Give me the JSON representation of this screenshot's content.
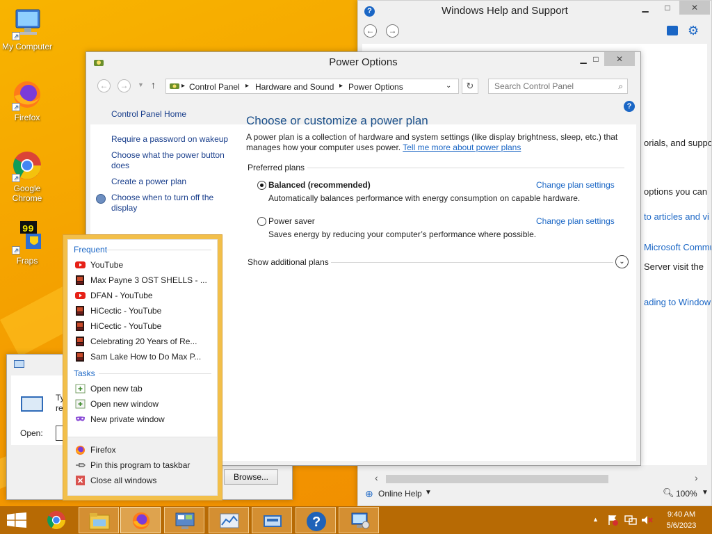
{
  "desktop": {
    "icons": [
      {
        "label": "My Computer"
      },
      {
        "label": "Firefox"
      },
      {
        "label": "Google Chrome"
      },
      {
        "label": "Fraps"
      }
    ]
  },
  "help_window": {
    "title": "Windows Help and Support",
    "snippets": [
      "orials, and suppo",
      "options you can",
      "to articles and vi",
      "Microsoft Commu",
      "Server visit the",
      "ading to Window"
    ],
    "online_help": "Online Help",
    "zoom": "100%"
  },
  "power_window": {
    "title": "Power Options",
    "breadcrumb": [
      "Control Panel",
      "Hardware and Sound",
      "Power Options"
    ],
    "search_placeholder": "Search Control Panel",
    "left_nav": {
      "home": "Control Panel Home",
      "links": [
        "Require a password on wakeup",
        "Choose what the power button does",
        "Create a power plan",
        "Choose when to turn off the display"
      ]
    },
    "heading": "Choose or customize a power plan",
    "intro": "A power plan is a collection of hardware and system settings (like display brightness, sleep, etc.) that manages how your computer uses power.",
    "intro_link": "Tell me more about power plans",
    "preferred_plans_label": "Preferred plans",
    "plans": [
      {
        "name": "Balanced (recommended)",
        "description": "Automatically balances performance with energy consumption on capable hardware.",
        "link": "Change plan settings",
        "selected": true
      },
      {
        "name": "Power saver",
        "description": "Saves energy by reducing your computer’s performance where possible.",
        "link": "Change plan settings",
        "selected": false
      }
    ],
    "show_additional": "Show additional plans"
  },
  "run_dialog": {
    "text_fragment_1": "Ty",
    "text_fragment_2": "re",
    "open_label": "Open:",
    "browse_label": "Browse..."
  },
  "jumplist": {
    "frequent_label": "Frequent",
    "frequent": [
      {
        "label": "YouTube",
        "icon": "youtube-icon"
      },
      {
        "label": "Max Payne 3 OST SHELLS - ...",
        "icon": "video-thumb-icon"
      },
      {
        "label": "DFAN - YouTube",
        "icon": "youtube-icon"
      },
      {
        "label": "HiCectic - YouTube",
        "icon": "video-thumb-icon"
      },
      {
        "label": "HiCectic - YouTube",
        "icon": "video-thumb-icon"
      },
      {
        "label": "Celebrating 20 Years of Re...",
        "icon": "video-thumb-icon"
      },
      {
        "label": "Sam Lake How to Do Max P...",
        "icon": "video-thumb-icon"
      }
    ],
    "tasks_label": "Tasks",
    "tasks": [
      {
        "label": "Open new tab",
        "icon": "new-tab-icon"
      },
      {
        "label": "Open new window",
        "icon": "new-window-icon"
      },
      {
        "label": "New private window",
        "icon": "private-mask-icon"
      }
    ],
    "footer": [
      {
        "label": "Firefox",
        "icon": "firefox-icon"
      },
      {
        "label": "Pin this program to taskbar",
        "icon": "pin-icon"
      },
      {
        "label": "Close all windows",
        "icon": "close-icon"
      }
    ]
  },
  "taskbar": {
    "time": "9:40 AM",
    "date": "5/6/2023"
  },
  "colors": {
    "accent_link": "#1a66c5",
    "desktop": "#f7a800",
    "taskbar": "#b76a04",
    "youtube_red": "#e62117"
  }
}
